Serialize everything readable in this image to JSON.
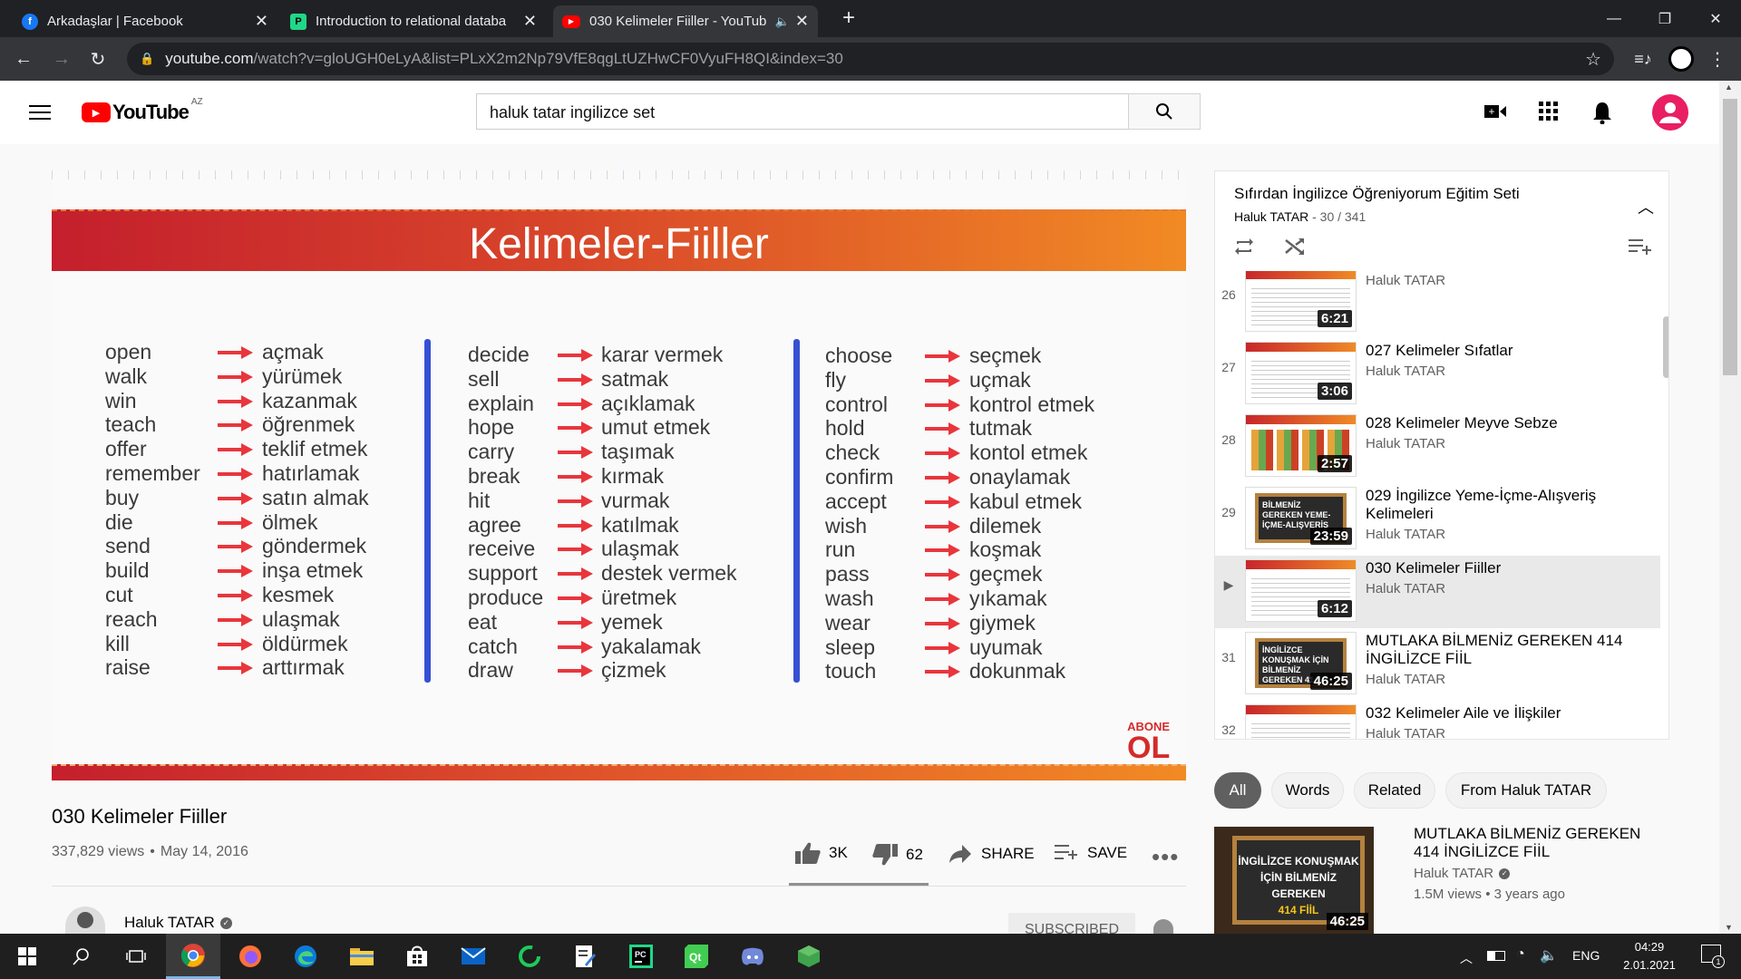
{
  "browser": {
    "tabs": [
      {
        "title": "Arkadaşlar | Facebook",
        "favicon": "facebook-icon",
        "color": "#1877f2"
      },
      {
        "title": "Introduction to relational databa",
        "favicon": "pycharm-edu-icon",
        "color": "#21d789"
      },
      {
        "title": "030 Kelimeler Fiiller - YouTub",
        "favicon": "youtube-icon",
        "color": "#ff0000",
        "active": true
      }
    ],
    "url_host": "youtube.com",
    "url_rest": "/watch?v=gloUGH0eLyA&list=PLxX2m2Np79VfE8qgLtUZHwCF0VyuFH8QI&index=30"
  },
  "youtube": {
    "logo_text": "YouTube",
    "region": "AZ",
    "search_value": "haluk tatar ingilizce set"
  },
  "slide": {
    "title": "Kelimeler-Fiiller",
    "columns": [
      {
        "en": [
          "open",
          "walk",
          "win",
          "teach",
          "offer",
          "remember",
          "buy",
          "die",
          "send",
          "build",
          "cut",
          "reach",
          "kill",
          "raise"
        ],
        "tr": [
          "açmak",
          "yürümek",
          "kazanmak",
          "öğrenmek",
          "teklif etmek",
          "hatırlamak",
          "satın almak",
          "ölmek",
          "göndermek",
          "inşa etmek",
          "kesmek",
          "ulaşmak",
          "öldürmek",
          "arttırmak"
        ]
      },
      {
        "en": [
          "decide",
          "sell",
          "explain",
          "hope",
          "carry",
          "break",
          "hit",
          "agree",
          "receive",
          "support",
          "produce",
          "eat",
          "catch",
          "draw"
        ],
        "tr": [
          "karar vermek",
          "satmak",
          "açıklamak",
          "umut etmek",
          "taşımak",
          "kırmak",
          "vurmak",
          "katılmak",
          "ulaşmak",
          "destek vermek",
          "üretmek",
          "yemek",
          "yakalamak",
          "çizmek"
        ]
      },
      {
        "en": [
          "choose",
          "fly",
          "control",
          "hold",
          "check",
          "confirm",
          "accept",
          "wish",
          "run",
          "pass",
          "wash",
          "wear",
          "sleep",
          "touch"
        ],
        "tr": [
          "seçmek",
          "uçmak",
          "kontrol etmek",
          "tutmak",
          "kontol etmek",
          "onaylamak",
          "kabul etmek",
          "dilemek",
          "koşmak",
          "geçmek",
          "yıkamak",
          "giymek",
          "uyumak",
          "dokunmak"
        ]
      }
    ],
    "badge_top": "ABONE",
    "badge_bottom": "OL"
  },
  "video": {
    "title": "030 Kelimeler Fiiller",
    "views": "337,829 views",
    "date": "May 14, 2016",
    "likes": "3K",
    "dislikes": "62",
    "share": "SHARE",
    "save": "SAVE",
    "channel": "Haluk TATAR",
    "subscribe": "SUBSCRIBED"
  },
  "playlist": {
    "title": "Sıfırdan İngilizce Öğreniyorum Eğitim Seti",
    "channel": "Haluk TATAR",
    "position": "30 / 341",
    "items": [
      {
        "num": "26",
        "title": "",
        "channel": "Haluk TATAR",
        "duration": "6:21",
        "style": "lines"
      },
      {
        "num": "27",
        "title": "027 Kelimeler Sıfatlar",
        "channel": "Haluk TATAR",
        "duration": "3:06",
        "style": "lines"
      },
      {
        "num": "28",
        "title": "028 Kelimeler Meyve Sebze",
        "channel": "Haluk TATAR",
        "duration": "2:57",
        "style": "food"
      },
      {
        "num": "29",
        "title": "029 İngilizce Yeme-İçme-Alışveriş Kelimeleri",
        "channel": "Haluk TATAR",
        "duration": "23:59",
        "style": "board",
        "board_text": "BİLMENİZ GEREKEN YEME-İÇME-ALIŞVERİŞ"
      },
      {
        "num": "▶",
        "title": "030 Kelimeler Fiiller",
        "channel": "Haluk TATAR",
        "duration": "6:12",
        "style": "lines",
        "current": true
      },
      {
        "num": "31",
        "title": "MUTLAKA BİLMENİZ GEREKEN 414 İNGİLİZCE FİİL",
        "channel": "Haluk TATAR",
        "duration": "46:25",
        "style": "board",
        "board_text": "İNGİLİZCE KONUŞMAK İÇİN BİLMENİZ GEREKEN 414"
      },
      {
        "num": "32",
        "title": "032 Kelimeler Aile ve İlişkiler",
        "channel": "Haluk TATAR",
        "duration": "",
        "style": "lines"
      }
    ]
  },
  "chips": [
    "All",
    "Words",
    "Related",
    "From Haluk TATAR"
  ],
  "recommended": {
    "title": "MUTLAKA BİLMENİZ GEREKEN 414 İNGİLİZCE FİİL",
    "channel": "Haluk TATAR",
    "meta": "1.5M views • 3 years ago",
    "duration": "46:25",
    "thumb_line1": "İNGİLİZCE KONUŞMAK",
    "thumb_line2": "İÇİN BİLMENİZ GEREKEN",
    "thumb_line3": "414 FİİL"
  },
  "taskbar": {
    "lang": "ENG",
    "time": "04:29",
    "date": "2.01.2021",
    "notif_count": "1"
  }
}
